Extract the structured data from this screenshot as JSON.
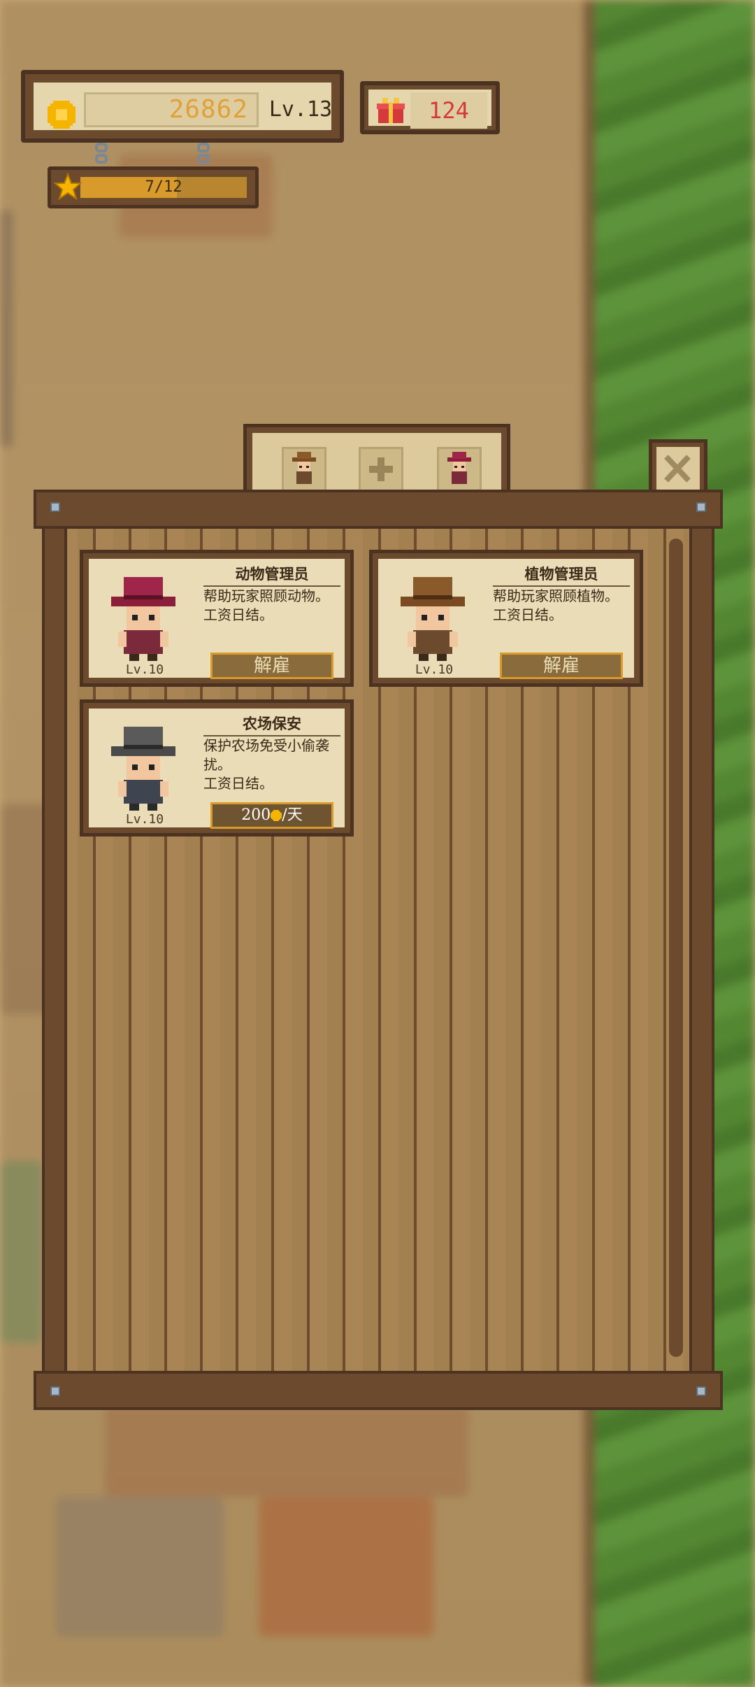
{
  "hud": {
    "coins": "26862",
    "level": "Lv.13",
    "gifts": "124",
    "stars_text": "7/12",
    "stars_progress": 0.58
  },
  "tabs": [
    {
      "name": "cowboy-tab"
    },
    {
      "name": "add-tab"
    },
    {
      "name": "red-hat-tab"
    }
  ],
  "workers": [
    {
      "title": "动物管理员",
      "desc": "帮助玩家照顾动物。",
      "wage_note": "工资日结。",
      "level": "Lv.10",
      "action": "解雇",
      "hat_color": "#8b1f3a"
    },
    {
      "title": "植物管理员",
      "desc": "帮助玩家照顾植物。",
      "wage_note": "工资日结。",
      "level": "Lv.10",
      "action": "解雇",
      "hat_color": "#7a4a22"
    },
    {
      "title": "农场保安",
      "desc": "保护农场免受小偷袭扰。",
      "wage_note": "工资日结。",
      "level": "Lv.10",
      "wage_amount": "200",
      "wage_unit": "/天",
      "hat_color": "#4a4a4a"
    }
  ],
  "colors": {
    "coin": "#f0a500",
    "gift": "#d53a3a",
    "frame": "#6b4a2e",
    "parchment": "#e9dcb6"
  }
}
